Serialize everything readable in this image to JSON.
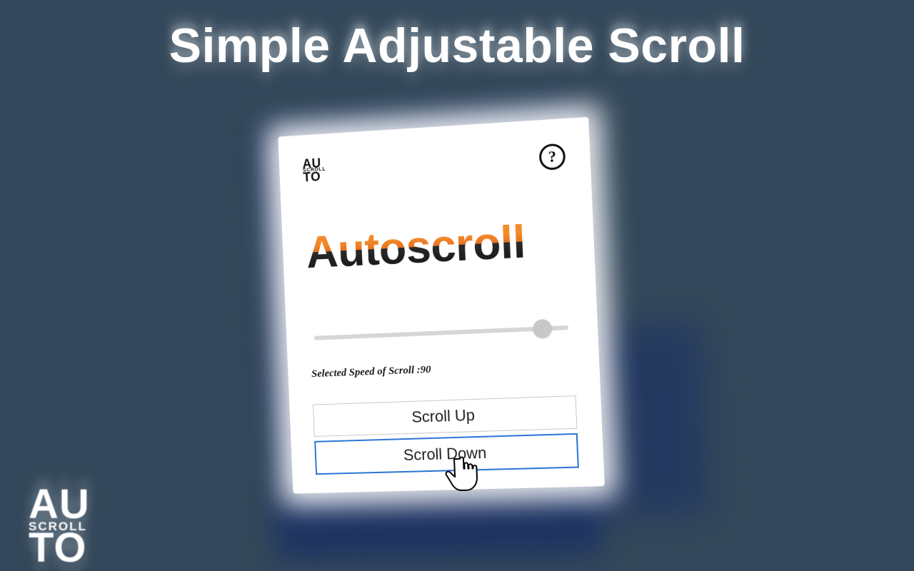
{
  "page_title": "Simple Adjustable Scroll",
  "corner_logo": {
    "line1": "AU",
    "line2": "SCROLL",
    "line3": "TO"
  },
  "card": {
    "mini_logo": {
      "line1": "AU",
      "line2": "SCROLL",
      "line3": "TO"
    },
    "help_glyph": "?",
    "app_title": "Autoscroll",
    "slider": {
      "value": 90,
      "min": 0,
      "max": 100
    },
    "speed_label_prefix": "Selected Speed of Scroll :",
    "speed_value": "90",
    "buttons": {
      "up": "Scroll Up",
      "down": "Scroll Down"
    }
  },
  "colors": {
    "background": "#33485a",
    "accent_orange": "#f28a2a",
    "button_active_border": "#2b74d6"
  }
}
